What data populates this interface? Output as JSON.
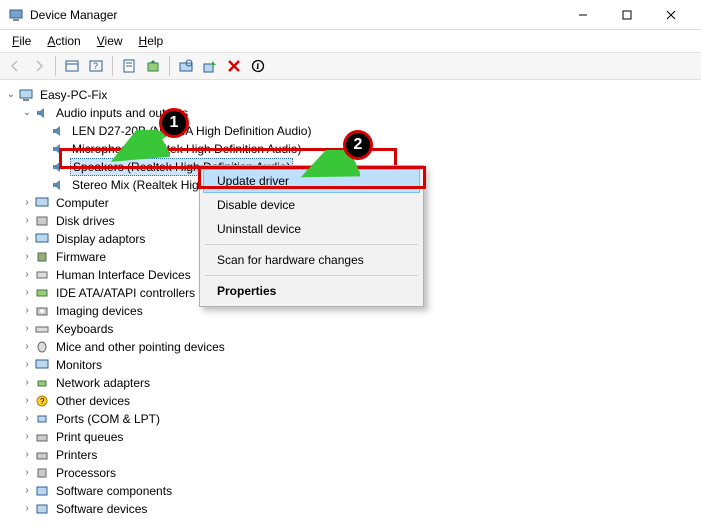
{
  "window": {
    "title": "Device Manager"
  },
  "menu": {
    "file": "File",
    "action": "Action",
    "view": "View",
    "help": "Help"
  },
  "tree": {
    "root": "Easy-PC-Fix",
    "audio_cat": "Audio inputs and outputs",
    "audio_items": [
      "LEN D27-20B (NVIDIA High Definition Audio)",
      "Microphone (Realtek High Definition Audio)",
      "Speakers (Realtek High Definition Audio)",
      "Stereo Mix (Realtek High Definition Audio)"
    ],
    "cats": [
      "Computer",
      "Disk drives",
      "Display adaptors",
      "Firmware",
      "Human Interface Devices",
      "IDE ATA/ATAPI controllers",
      "Imaging devices",
      "Keyboards",
      "Mice and other pointing devices",
      "Monitors",
      "Network adapters",
      "Other devices",
      "Ports (COM & LPT)",
      "Print queues",
      "Printers",
      "Processors",
      "Software components",
      "Software devices"
    ]
  },
  "context": {
    "update": "Update driver",
    "disable": "Disable device",
    "uninstall": "Uninstall device",
    "scan": "Scan for hardware changes",
    "properties": "Properties"
  },
  "badges": {
    "one": "1",
    "two": "2"
  }
}
